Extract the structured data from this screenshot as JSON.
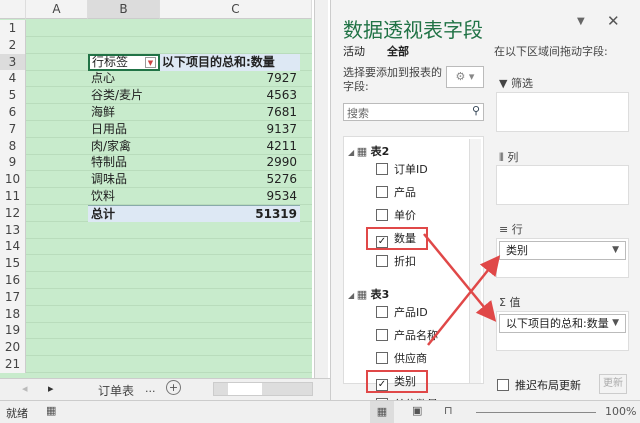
{
  "sheet": {
    "columns": [
      "A",
      "B",
      "C"
    ],
    "rows": [
      "1",
      "2",
      "3",
      "4",
      "5",
      "6",
      "7",
      "8",
      "9",
      "10",
      "11",
      "12",
      "13",
      "14",
      "15",
      "16",
      "17",
      "18",
      "19",
      "20",
      "21"
    ],
    "pivot": {
      "row_label_header": "行标签",
      "value_header": "以下项目的总和:数量",
      "items": [
        {
          "label": "点心",
          "value": "7927"
        },
        {
          "label": "谷类/麦片",
          "value": "4563"
        },
        {
          "label": "海鲜",
          "value": "7681"
        },
        {
          "label": "日用品",
          "value": "9137"
        },
        {
          "label": "肉/家禽",
          "value": "4211"
        },
        {
          "label": "特制品",
          "value": "2990"
        },
        {
          "label": "调味品",
          "value": "5276"
        },
        {
          "label": "饮料",
          "value": "9534"
        }
      ],
      "total_label": "总计",
      "total_value": "51319"
    },
    "tab_name": "订单表",
    "tab_more": "..."
  },
  "panel": {
    "title": "数据透视表字段",
    "tab_active": "活动",
    "tab_all": "全部",
    "choose_label": "选择要添加到报表的字段:",
    "search_placeholder": "搜索",
    "drag_label": "在以下区域间拖动字段:",
    "tables": [
      {
        "name": "表2",
        "fields": [
          {
            "name": "订单ID",
            "checked": false
          },
          {
            "name": "产品",
            "checked": false
          },
          {
            "name": "单价",
            "checked": false
          },
          {
            "name": "数量",
            "checked": true
          },
          {
            "name": "折扣",
            "checked": false
          }
        ]
      },
      {
        "name": "表3",
        "fields": [
          {
            "name": "产品ID",
            "checked": false
          },
          {
            "name": "产品名称",
            "checked": false
          },
          {
            "name": "供应商",
            "checked": false
          },
          {
            "name": "类别",
            "checked": true
          },
          {
            "name": "单位数量",
            "checked": false
          }
        ]
      }
    ],
    "filters_label": "筛选",
    "columns_label": "列",
    "rows_label": "行",
    "rows_value": "类别",
    "values_label": "值",
    "values_value": "以下项目的总和:数量",
    "defer_label": "推迟布局更新",
    "update_label": "更新"
  },
  "status": {
    "ready": "就绪",
    "zoom": "100%"
  },
  "colors": {
    "accent": "#217346",
    "highlight": "#e04848",
    "grid": "#c8ebcc"
  }
}
